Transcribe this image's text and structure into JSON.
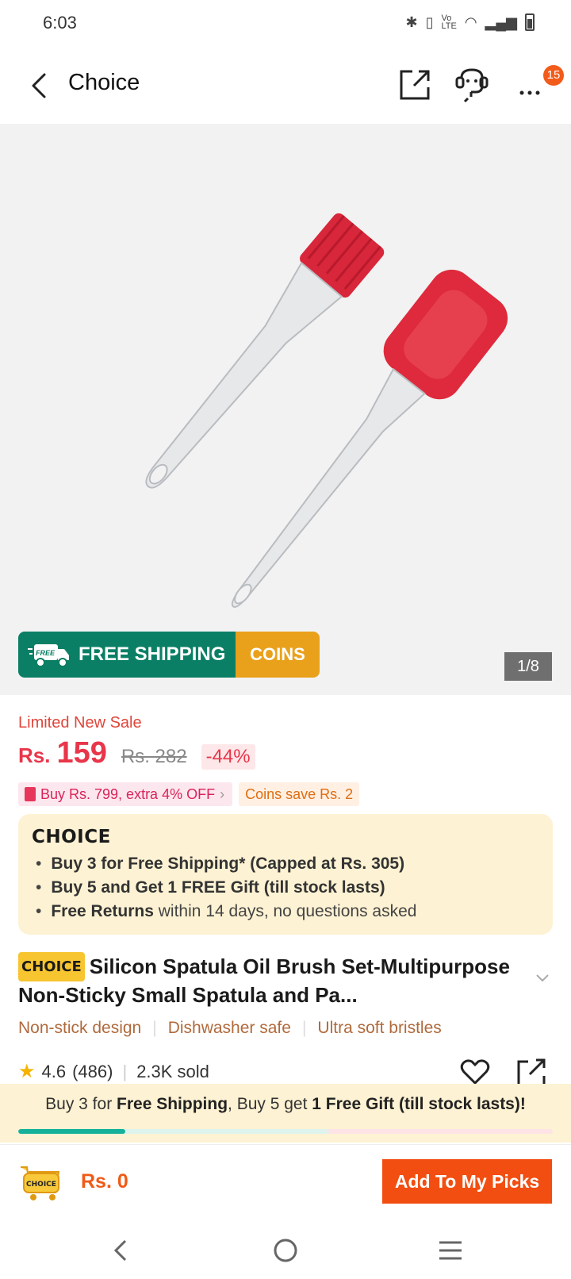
{
  "status_bar": {
    "time": "6:03"
  },
  "header": {
    "title": "Choice",
    "notification_count": "15"
  },
  "gallery": {
    "free_shipping_label": "FREE SHIPPING",
    "free_tag": "FREE",
    "coins_label": "COINS",
    "counter": "1/8"
  },
  "pricing": {
    "limited_label": "Limited New Sale",
    "currency": "Rs.",
    "price": "159",
    "original_price": "Rs. 282",
    "discount": "-44%",
    "coupon": "Buy Rs. 799, extra 4% OFF",
    "coins_save": "Coins save Rs. 2"
  },
  "choice_box": {
    "logo": "CHOICE",
    "bullets": [
      {
        "bold": "Buy 3 for  Free Shipping* (Capped at Rs. 305)",
        "rest": ""
      },
      {
        "bold": "Buy 5 and Get 1 FREE Gift (till stock lasts)",
        "rest": ""
      },
      {
        "bold": "Free Returns",
        "rest": " within 14 days, no questions asked"
      }
    ]
  },
  "product": {
    "chip": "CHOICE",
    "title": "Silicon Spatula Oil Brush Set-Multipurpose Non-Sticky Small Spatula and Pa...",
    "features": [
      "Non-stick design",
      "Dishwasher safe",
      "Ultra soft bristles"
    ],
    "rating": "4.6",
    "reviews": "(486)",
    "sold": "2.3K sold"
  },
  "sticky_bar": {
    "part1": "Buy 3 for ",
    "bold1": "Free Shipping",
    "part2": ", Buy 5 get ",
    "bold2": "1 Free Gift (till stock lasts)!",
    "progress_fraction": 0.2
  },
  "bottom_bar": {
    "cart_label": "CHOICE",
    "total": "Rs. 0",
    "add_button": "Add To My Picks"
  },
  "colors": {
    "accent": "#f24e11",
    "price": "#e8364a",
    "free_shipping_green": "#0b7f65",
    "coins_orange": "#e9a11b",
    "choice_yellow": "#f7c530"
  }
}
